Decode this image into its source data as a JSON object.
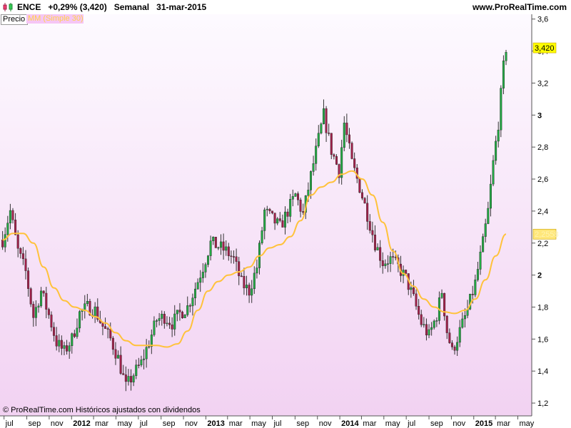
{
  "header": {
    "ticker": "ENCE",
    "change": "+0,29% (3,420)",
    "period": "Semanal",
    "date": "31-mar-2015",
    "site": "www.ProRealTime.com"
  },
  "legend": {
    "price_label": "Precio",
    "ma_label": "MM (Simple 30)"
  },
  "footer": {
    "note": "© ProRealTime.com  Históricos ajustados con dividendos"
  },
  "colors": {
    "background_top": "#fdfaff",
    "background_bottom": "#f2d3f2",
    "bull_candle": "#22aa44",
    "bear_candle": "#a2204a",
    "ma_line": "#ffc23a",
    "last_price_badge": "#ffff00",
    "ma_badge": "#ffe77a"
  },
  "chart_data": {
    "type": "candlestick",
    "title": "ENCE",
    "yaxis": {
      "ticks": [
        "1,2",
        "1,4",
        "1,6",
        "1,8",
        "2",
        "2,2",
        "2,4",
        "2,6",
        "2,8",
        "3",
        "3,2",
        "3,4",
        "3,6"
      ],
      "tick_values": [
        1.2,
        1.4,
        1.6,
        1.8,
        2.0,
        2.2,
        2.4,
        2.6,
        2.8,
        3.0,
        3.2,
        3.4,
        3.6
      ],
      "ylim": [
        1.12,
        3.63
      ]
    },
    "xaxis": {
      "labels": [
        {
          "label": "jul",
          "date": "2011-07",
          "bold": false
        },
        {
          "label": "sep",
          "date": "2011-09",
          "bold": false
        },
        {
          "label": "nov",
          "date": "2011-11",
          "bold": false
        },
        {
          "label": "2012",
          "date": "2012-01",
          "bold": true
        },
        {
          "label": "mar",
          "date": "2012-03",
          "bold": false
        },
        {
          "label": "may",
          "date": "2012-05",
          "bold": false
        },
        {
          "label": "jul",
          "date": "2012-07",
          "bold": false
        },
        {
          "label": "sep",
          "date": "2012-09",
          "bold": false
        },
        {
          "label": "nov",
          "date": "2012-11",
          "bold": false
        },
        {
          "label": "2013",
          "date": "2013-01",
          "bold": true
        },
        {
          "label": "mar",
          "date": "2013-03",
          "bold": false
        },
        {
          "label": "may",
          "date": "2013-05",
          "bold": false
        },
        {
          "label": "jul",
          "date": "2013-07",
          "bold": false
        },
        {
          "label": "sep",
          "date": "2013-09",
          "bold": false
        },
        {
          "label": "nov",
          "date": "2013-11",
          "bold": false
        },
        {
          "label": "2014",
          "date": "2014-01",
          "bold": true
        },
        {
          "label": "mar",
          "date": "2014-03",
          "bold": false
        },
        {
          "label": "may",
          "date": "2014-05",
          "bold": false
        },
        {
          "label": "jul",
          "date": "2014-07",
          "bold": false
        },
        {
          "label": "sep",
          "date": "2014-09",
          "bold": false
        },
        {
          "label": "nov",
          "date": "2014-11",
          "bold": false
        },
        {
          "label": "2015",
          "date": "2015-01",
          "bold": true
        },
        {
          "label": "mar",
          "date": "2015-03",
          "bold": false
        },
        {
          "label": "may",
          "date": "2015-05",
          "bold": false
        }
      ],
      "xlim": [
        "2011-06-20",
        "2015-06-08"
      ]
    },
    "last_price": {
      "value": 3.42,
      "label": "3,420"
    },
    "ma_last": {
      "value": 2.2558,
      "label": "2,2558"
    },
    "price_path": [
      [
        "2011-06-27",
        2.22
      ],
      [
        "2011-07-18",
        2.4
      ],
      [
        "2011-08-08",
        2.15
      ],
      [
        "2011-08-29",
        2.02
      ],
      [
        "2011-09-19",
        1.74
      ],
      [
        "2011-10-10",
        1.9
      ],
      [
        "2011-10-31",
        1.75
      ],
      [
        "2011-11-21",
        1.58
      ],
      [
        "2011-12-12",
        1.52
      ],
      [
        "2012-01-02",
        1.6
      ],
      [
        "2012-01-23",
        1.76
      ],
      [
        "2012-02-13",
        1.8
      ],
      [
        "2012-03-05",
        1.78
      ],
      [
        "2012-03-26",
        1.68
      ],
      [
        "2012-04-16",
        1.6
      ],
      [
        "2012-05-07",
        1.48
      ],
      [
        "2012-05-28",
        1.3
      ],
      [
        "2012-06-18",
        1.38
      ],
      [
        "2012-07-09",
        1.45
      ],
      [
        "2012-07-30",
        1.58
      ],
      [
        "2012-08-20",
        1.72
      ],
      [
        "2012-09-10",
        1.74
      ],
      [
        "2012-10-01",
        1.7
      ],
      [
        "2012-10-22",
        1.76
      ],
      [
        "2012-11-12",
        1.8
      ],
      [
        "2012-12-03",
        1.92
      ],
      [
        "2012-12-24",
        2.05
      ],
      [
        "2013-01-14",
        2.2
      ],
      [
        "2013-02-04",
        2.18
      ],
      [
        "2013-02-25",
        2.15
      ],
      [
        "2013-03-18",
        2.1
      ],
      [
        "2013-04-08",
        1.95
      ],
      [
        "2013-04-29",
        1.9
      ],
      [
        "2013-05-20",
        2.05
      ],
      [
        "2013-06-10",
        2.4
      ],
      [
        "2013-07-01",
        2.35
      ],
      [
        "2013-07-22",
        2.3
      ],
      [
        "2013-08-12",
        2.4
      ],
      [
        "2013-09-02",
        2.5
      ],
      [
        "2013-09-23",
        2.38
      ],
      [
        "2013-10-14",
        2.62
      ],
      [
        "2013-11-04",
        2.85
      ],
      [
        "2013-11-18",
        3.0
      ],
      [
        "2013-12-09",
        2.78
      ],
      [
        "2013-12-30",
        2.65
      ],
      [
        "2014-01-13",
        2.95
      ],
      [
        "2014-02-03",
        2.7
      ],
      [
        "2014-02-24",
        2.55
      ],
      [
        "2014-03-17",
        2.38
      ],
      [
        "2014-04-07",
        2.2
      ],
      [
        "2014-04-28",
        2.08
      ],
      [
        "2014-05-19",
        2.1
      ],
      [
        "2014-06-09",
        2.05
      ],
      [
        "2014-06-30",
        1.98
      ],
      [
        "2014-07-21",
        1.85
      ],
      [
        "2014-08-11",
        1.7
      ],
      [
        "2014-09-01",
        1.62
      ],
      [
        "2014-09-22",
        1.75
      ],
      [
        "2014-10-06",
        1.9
      ],
      [
        "2014-10-20",
        1.65
      ],
      [
        "2014-11-03",
        1.52
      ],
      [
        "2014-11-24",
        1.65
      ],
      [
        "2014-12-15",
        1.78
      ],
      [
        "2015-01-05",
        1.95
      ],
      [
        "2015-01-26",
        2.2
      ],
      [
        "2015-02-09",
        2.4
      ],
      [
        "2015-02-23",
        2.7
      ],
      [
        "2015-03-09",
        2.95
      ],
      [
        "2015-03-23",
        3.3
      ],
      [
        "2015-03-30",
        3.42
      ]
    ],
    "moving_average": {
      "name": "MM (Simple 30)",
      "points": [
        [
          "2011-06-27",
          2.22
        ],
        [
          "2011-07-25",
          2.26
        ],
        [
          "2011-08-22",
          2.26
        ],
        [
          "2011-09-19",
          2.2
        ],
        [
          "2011-10-17",
          2.05
        ],
        [
          "2011-11-14",
          1.92
        ],
        [
          "2011-12-12",
          1.84
        ],
        [
          "2012-01-09",
          1.8
        ],
        [
          "2012-02-06",
          1.78
        ],
        [
          "2012-03-05",
          1.74
        ],
        [
          "2012-04-02",
          1.7
        ],
        [
          "2012-04-30",
          1.64
        ],
        [
          "2012-05-28",
          1.59
        ],
        [
          "2012-06-25",
          1.56
        ],
        [
          "2012-07-23",
          1.56
        ],
        [
          "2012-08-20",
          1.56
        ],
        [
          "2012-09-17",
          1.55
        ],
        [
          "2012-10-15",
          1.57
        ],
        [
          "2012-11-12",
          1.65
        ],
        [
          "2012-12-10",
          1.78
        ],
        [
          "2013-01-07",
          1.9
        ],
        [
          "2013-02-04",
          1.96
        ],
        [
          "2013-03-04",
          2.0
        ],
        [
          "2013-04-01",
          2.02
        ],
        [
          "2013-04-29",
          2.05
        ],
        [
          "2013-05-27",
          2.12
        ],
        [
          "2013-06-24",
          2.17
        ],
        [
          "2013-07-22",
          2.19
        ],
        [
          "2013-08-19",
          2.24
        ],
        [
          "2013-09-16",
          2.34
        ],
        [
          "2013-10-14",
          2.5
        ],
        [
          "2013-11-11",
          2.55
        ],
        [
          "2013-12-09",
          2.58
        ],
        [
          "2014-01-06",
          2.63
        ],
        [
          "2014-02-03",
          2.65
        ],
        [
          "2014-03-03",
          2.6
        ],
        [
          "2014-03-31",
          2.5
        ],
        [
          "2014-04-28",
          2.33
        ],
        [
          "2014-05-26",
          2.15
        ],
        [
          "2014-06-23",
          2.01
        ],
        [
          "2014-07-21",
          1.93
        ],
        [
          "2014-08-18",
          1.85
        ],
        [
          "2014-09-15",
          1.8
        ],
        [
          "2014-10-13",
          1.77
        ],
        [
          "2014-11-10",
          1.76
        ],
        [
          "2014-12-08",
          1.78
        ],
        [
          "2015-01-05",
          1.85
        ],
        [
          "2015-02-02",
          1.97
        ],
        [
          "2015-03-02",
          2.12
        ],
        [
          "2015-03-30",
          2.2558
        ]
      ]
    },
    "candles_per_week": true,
    "grid": false,
    "legend": "top-left"
  }
}
